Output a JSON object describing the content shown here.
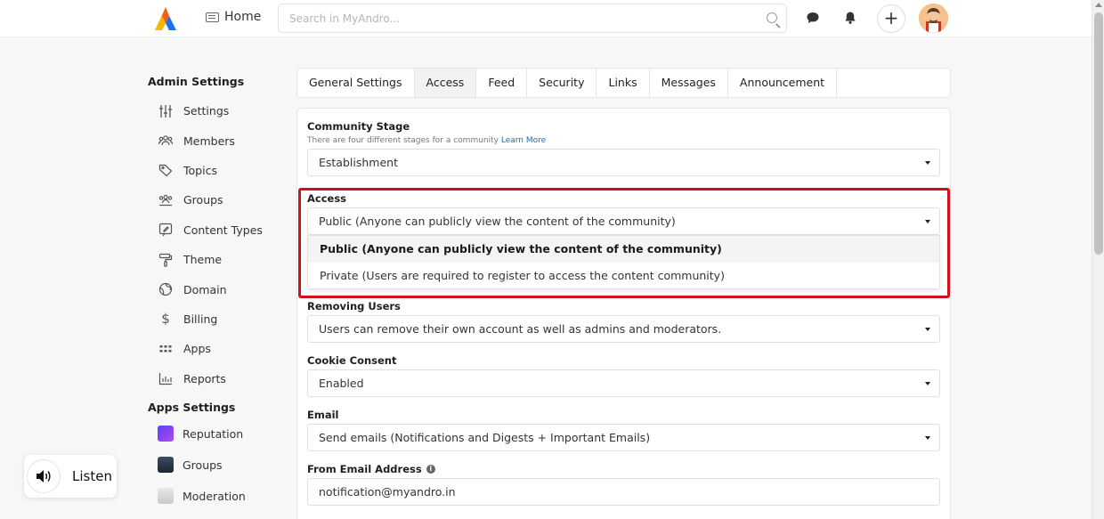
{
  "topbar": {
    "home_label": "Home",
    "search_placeholder": "Search in MyAndro...",
    "icons": [
      "logo-icon",
      "home-icon",
      "search-icon",
      "chat-icon",
      "bell-icon",
      "plus-icon",
      "avatar"
    ]
  },
  "sidebar": {
    "admin_heading": "Admin Settings",
    "items": [
      {
        "label": "Settings",
        "icon": "sliders-icon"
      },
      {
        "label": "Members",
        "icon": "members-icon"
      },
      {
        "label": "Topics",
        "icon": "tag-icon"
      },
      {
        "label": "Groups",
        "icon": "groups-icon"
      },
      {
        "label": "Content Types",
        "icon": "content-types-icon"
      },
      {
        "label": "Theme",
        "icon": "paint-roller-icon"
      },
      {
        "label": "Domain",
        "icon": "globe-icon"
      },
      {
        "label": "Billing",
        "icon": "dollar-icon"
      },
      {
        "label": "Apps",
        "icon": "apps-grid-icon"
      },
      {
        "label": "Reports",
        "icon": "bar-chart-icon"
      }
    ],
    "apps_heading": "Apps Settings",
    "apps": [
      {
        "label": "Reputation"
      },
      {
        "label": "Groups"
      },
      {
        "label": "Moderation"
      }
    ]
  },
  "tabs": [
    {
      "label": "General Settings",
      "active": false
    },
    {
      "label": "Access",
      "active": true
    },
    {
      "label": "Feed",
      "active": false
    },
    {
      "label": "Security",
      "active": false
    },
    {
      "label": "Links",
      "active": false
    },
    {
      "label": "Messages",
      "active": false
    },
    {
      "label": "Announcement",
      "active": false
    }
  ],
  "form": {
    "community_stage": {
      "label": "Community Stage",
      "help_text": "There are four different stages for a community",
      "help_link": "Learn More",
      "value": "Establishment"
    },
    "access": {
      "label": "Access",
      "value": "Public (Anyone can publicly view the content of the community)",
      "options": [
        "Public (Anyone can publicly view the content of the community)",
        "Private (Users are required to register to access the content community)"
      ]
    },
    "removing_users": {
      "label": "Removing Users",
      "value": "Users can remove their own account as well as admins and moderators."
    },
    "cookie_consent": {
      "label": "Cookie Consent",
      "value": "Enabled"
    },
    "email": {
      "label": "Email",
      "value": "Send emails (Notifications and Digests + Important Emails)"
    },
    "from_email": {
      "label": "From Email Address",
      "value": "notification@myandro.in"
    }
  },
  "listen_widget": {
    "label": "Listen"
  },
  "colors": {
    "highlight": "#d0101c",
    "link": "#2563c9",
    "logo_yellow": "#f7b500",
    "logo_blue": "#1a73e8"
  }
}
